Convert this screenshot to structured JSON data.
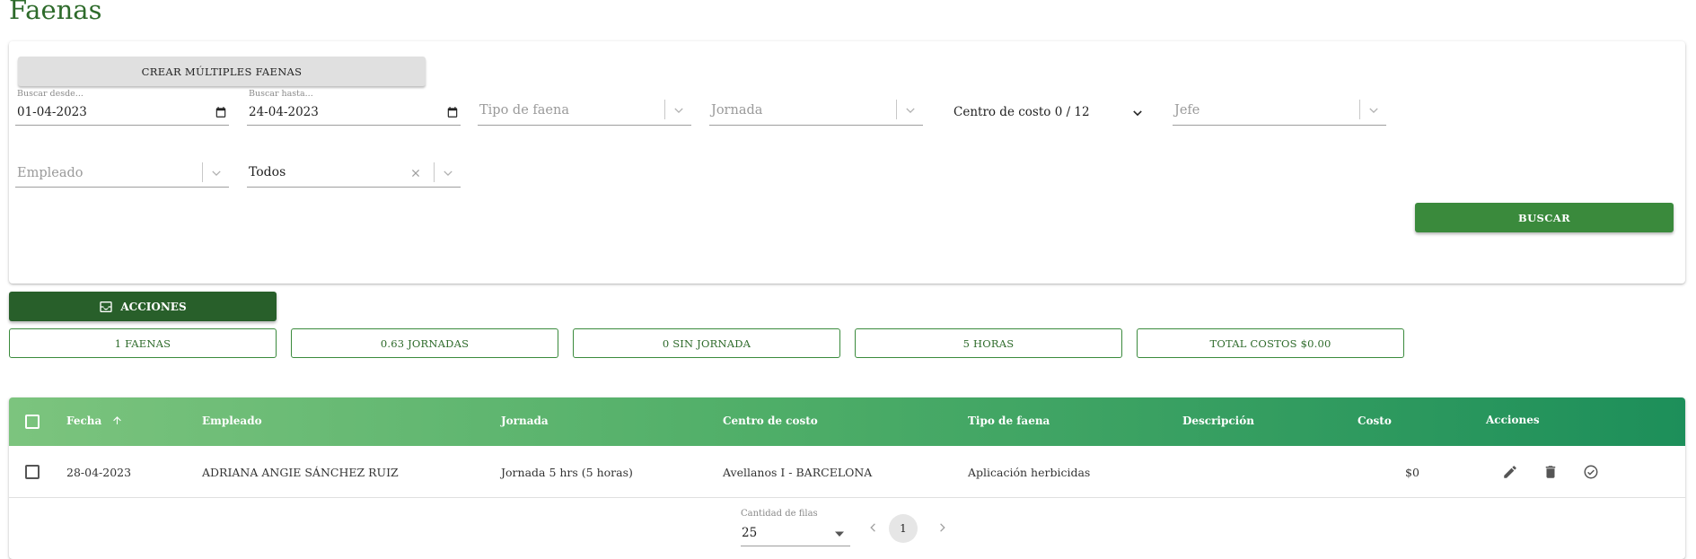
{
  "page": {
    "title": "Faenas"
  },
  "filters": {
    "create_multiple_label": "CREAR MÚLTIPLES FAENAS",
    "date_from": {
      "label": "Buscar desde...",
      "value": "01-04-2023"
    },
    "date_to": {
      "label": "Buscar hasta...",
      "value": "24-04-2023"
    },
    "tipo_faena": {
      "placeholder": "Tipo de faena"
    },
    "jornada": {
      "placeholder": "Jornada"
    },
    "centro_costo": {
      "value": "Centro de costo 0 / 12"
    },
    "jefe": {
      "placeholder": "Jefe"
    },
    "empleado": {
      "placeholder": "Empleado"
    },
    "estado": {
      "value": "Todos"
    },
    "search_label": "BUSCAR"
  },
  "actions": {
    "label": "ACCIONES"
  },
  "summary": [
    {
      "label": "1 FAENAS"
    },
    {
      "label": "0.63 JORNADAS"
    },
    {
      "label": "0 SIN JORNADA"
    },
    {
      "label": "5 HORAS"
    },
    {
      "label": "TOTAL COSTOS $0.00"
    }
  ],
  "table": {
    "columns": {
      "fecha": "Fecha",
      "empleado": "Empleado",
      "jornada": "Jornada",
      "centro": "Centro de costo",
      "tipo": "Tipo de faena",
      "descripcion": "Descripción",
      "costo": "Costo",
      "acciones": "Acciones"
    },
    "rows": [
      {
        "fecha": "28-04-2023",
        "empleado": "ADRIANA ANGIE SÁNCHEZ RUIZ",
        "jornada": "Jornada 5 hrs (5 horas)",
        "centro": "Avellanos I - BARCELONA",
        "tipo": "Aplicación herbicidas",
        "descripcion": "",
        "costo": "$0"
      }
    ],
    "pagination": {
      "rows_label": "Cantidad de filas",
      "rows_value": "25",
      "current_page": "1"
    }
  },
  "colors": {
    "primary": "#3a8a3c",
    "primary_dark": "#285f2a",
    "title": "#2e6b2b",
    "header_gradient_start": "#7cc47e",
    "header_gradient_end": "#1d8f5a"
  },
  "icons": [
    "calendar-icon",
    "chevron-down-icon",
    "clear-icon",
    "inbox-icon",
    "sort-arrow-up-icon",
    "edit-icon",
    "delete-icon",
    "check-circle-icon",
    "chevron-left-icon",
    "chevron-right-icon",
    "caret-down-icon"
  ]
}
